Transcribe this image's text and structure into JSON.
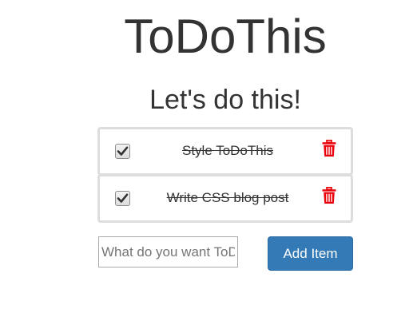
{
  "header": {
    "title": "ToDoThis",
    "subtitle": "Let's do this!"
  },
  "todos": [
    {
      "text": "Style ToDoThis",
      "completed": true
    },
    {
      "text": "Write CSS blog post",
      "completed": true
    }
  ],
  "form": {
    "input_value": "",
    "input_placeholder": "What do you want ToDo?",
    "add_label": "Add Item"
  },
  "colors": {
    "delete_icon": "#e8000b",
    "add_button": "#337ab7",
    "text": "#333333"
  },
  "icons": {
    "check": "checkmark-icon",
    "delete": "trash-icon"
  }
}
